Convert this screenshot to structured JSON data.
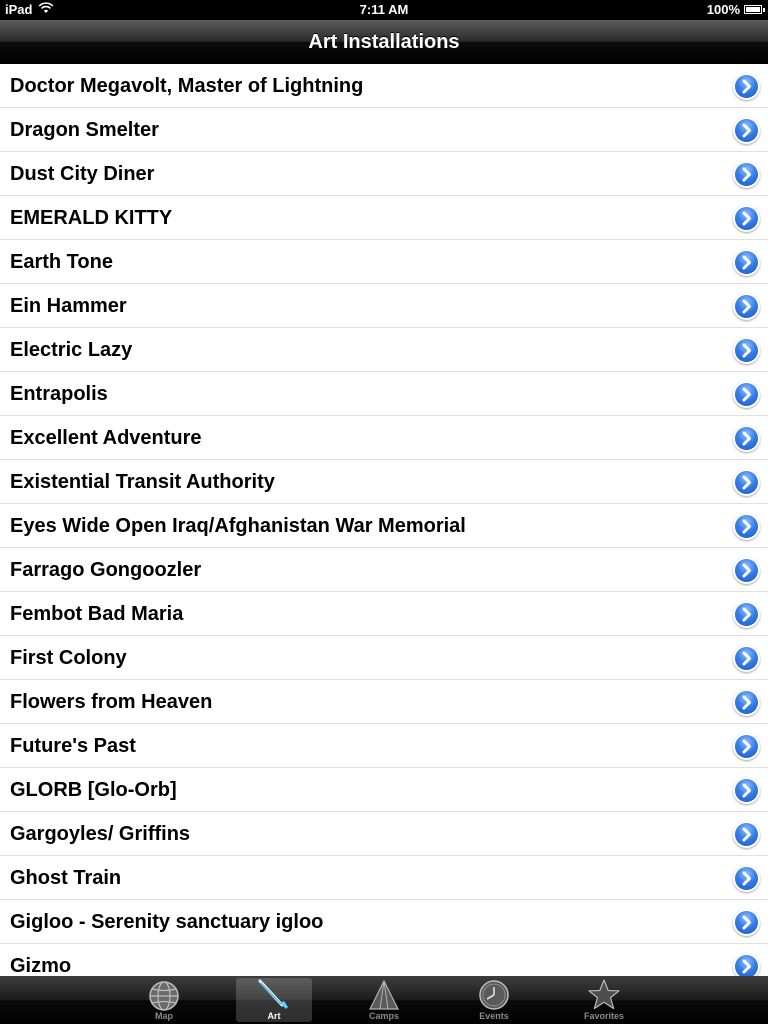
{
  "status_bar": {
    "carrier": "iPad",
    "time": "7:11 AM",
    "battery": "100%",
    "battery_level": 1.0
  },
  "nav_bar": {
    "title": "Art Installations"
  },
  "list": {
    "items": [
      {
        "label": "Doctor Megavolt, Master of Lightning"
      },
      {
        "label": "Dragon Smelter"
      },
      {
        "label": "Dust City Diner"
      },
      {
        "label": "EMERALD KITTY"
      },
      {
        "label": "Earth Tone"
      },
      {
        "label": "Ein Hammer"
      },
      {
        "label": "Electric Lazy"
      },
      {
        "label": "Entrapolis"
      },
      {
        "label": "Excellent Adventure"
      },
      {
        "label": "Existential Transit Authority"
      },
      {
        "label": "Eyes Wide Open Iraq/Afghanistan War Memorial"
      },
      {
        "label": "Farrago Gongoozler"
      },
      {
        "label": "Fembot Bad Maria"
      },
      {
        "label": "First Colony"
      },
      {
        "label": "Flowers from Heaven"
      },
      {
        "label": "Future's Past"
      },
      {
        "label": "GLORB [Glo-Orb]"
      },
      {
        "label": "Gargoyles/ Griffins"
      },
      {
        "label": "Ghost Train"
      },
      {
        "label": "Gigloo - Serenity sanctuary igloo"
      },
      {
        "label": "Gizmo"
      }
    ],
    "accessory_icon": "detail-disclosure-icon",
    "accessory_color": "#2f6fdc"
  },
  "tab_bar": {
    "tabs": [
      {
        "label": "Map",
        "icon": "globe-icon"
      },
      {
        "label": "Art",
        "icon": "paintbrush-icon",
        "selected": true
      },
      {
        "label": "Camps",
        "icon": "tent-icon"
      },
      {
        "label": "Events",
        "icon": "clock-icon"
      },
      {
        "label": "Favorites",
        "icon": "star-icon"
      }
    ]
  }
}
